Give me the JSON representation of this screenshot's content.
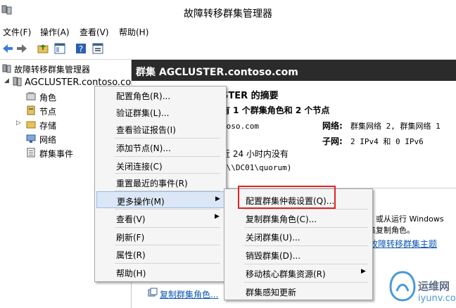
{
  "window": {
    "title": "故障转移群集管理器"
  },
  "menubar": [
    "文件(F)",
    "操作(A)",
    "查看(V)",
    "帮助(H)"
  ],
  "toolbar": {
    "icons": [
      "back-arrow-icon",
      "forward-arrow-icon",
      "folder-up-icon",
      "show-hide-tree-icon",
      "help-icon",
      "properties-icon"
    ]
  },
  "tree": {
    "root": "故障转移群集管理器",
    "cluster": "AGCLUSTER.contoso.com",
    "children": [
      "角色",
      "节点",
      "存储",
      "网络",
      "群集事件"
    ]
  },
  "summary": {
    "header": "群集 AGCLUSTER.contoso.com",
    "heading": "STER 的摘要",
    "line2": "有 1 个群集角色和 2 个节点",
    "domain_partial": "toso.com",
    "two": "2",
    "events_partial": "近 24 小时内没有",
    "quorum_partial": "(\\\\DC01\\quorum)",
    "net_label": "网络:",
    "net_value": "群集网络 2, 群集网络 1",
    "subnet_label": "子网:",
    "subnet_value": "2 IPv4 和 0 IPv6",
    "text_a": "，或从运行 Windows",
    "text_b": "集复制角色。",
    "link_a": "故障转移群集主题",
    "link_b": "复制群集角色..."
  },
  "context_menu": {
    "items": [
      "配置角色(R)...",
      "验证群集(L)...",
      "查看验证报告(I)",
      "添加节点(N)...",
      "关闭连接(C)",
      "重置最近的事件(R)",
      "更多操作(M)",
      "查看(V)",
      "刷新(F)",
      "属性(R)",
      "帮助(H)"
    ]
  },
  "submenu": {
    "items": [
      "配置群集仲裁设置(Q)...",
      "复制群集角色(C)...",
      "关闭群集(U)...",
      "销毁群集(D)...",
      "移动核心群集资源(R)",
      "群集感知更新"
    ]
  },
  "watermark": {
    "cn": "运维网",
    "en": "iyunv.com"
  }
}
